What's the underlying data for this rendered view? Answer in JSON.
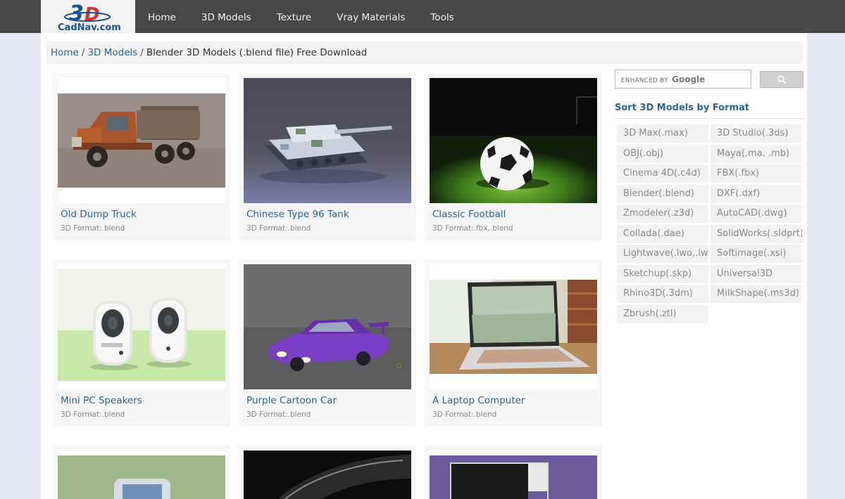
{
  "logo": {
    "alt": "CadNav.com"
  },
  "nav": [
    "Home",
    "3D Models",
    "Texture",
    "Vray Materials",
    "Tools"
  ],
  "breadcrumb": {
    "home": "Home",
    "models": "3D Models",
    "current": "Blender 3D Models (.blend file) Free Download"
  },
  "models": [
    {
      "title": "Old Dump Truck",
      "format": "3D Format:.blend",
      "thumb": "truck-image"
    },
    {
      "title": "Chinese Type 96 Tank",
      "format": "3D Format:.blend",
      "thumb": "tank-image"
    },
    {
      "title": "Classic Football",
      "format": "3D Format:.fbx,.blend",
      "thumb": "football-image"
    },
    {
      "title": "Mini PC Speakers",
      "format": "3D Format:.blend",
      "thumb": "speakers-image"
    },
    {
      "title": "Purple Cartoon Car",
      "format": "3D Format:.blend",
      "thumb": "car-image"
    },
    {
      "title": "A Laptop Computer",
      "format": "3D Format:.blend",
      "thumb": "laptop-image"
    }
  ],
  "search": {
    "enhanced_label": "ENHANCED BY",
    "google_label": "Google",
    "button_icon": "search-icon"
  },
  "sidebar": {
    "title": "Sort 3D Models by Format",
    "formats": [
      "3D Max(.max)",
      "3D Studio(.3ds)",
      "OBJ(.obj)",
      "Maya(.ma, .mb)",
      "Cinema 4D(.c4d)",
      "FBX(.fbx)",
      "Blender(.blend)",
      "DXF(.dxf)",
      "Zmodeler(.z3d)",
      "AutoCAD(.dwg)",
      "Collada(.dae)",
      "SolidWorks(.sldprt)",
      "Lightwave(.lwo,.lws)",
      "Softimage(.xsi)",
      "Sketchup(.skp)",
      "Universal3D",
      "Rhino3D(.3dm)",
      "MilkShape(.ms3d)",
      "Zbrush(.ztl)"
    ]
  },
  "colors": {
    "topbar": "#474747",
    "link": "#2a6496",
    "muted": "#8a8a8a",
    "page_bg": "#e6eaf0"
  }
}
